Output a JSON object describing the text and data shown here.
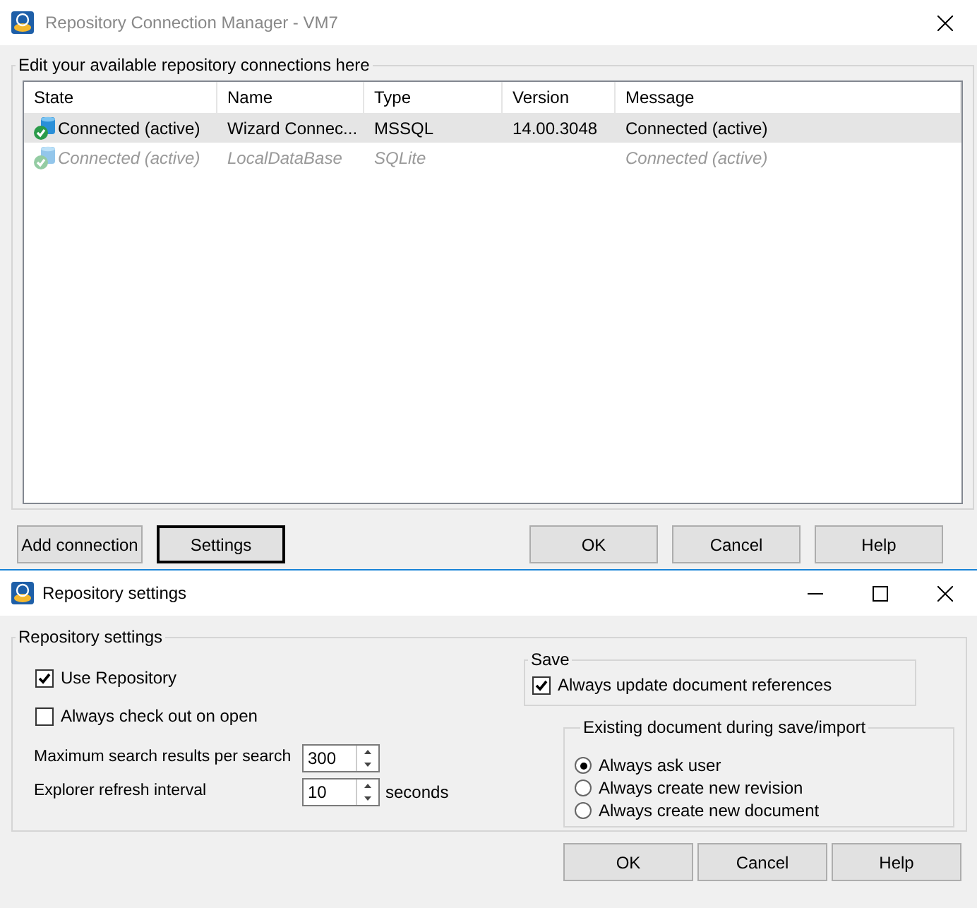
{
  "main_window": {
    "title": "Repository Connection Manager - VM7",
    "active": false,
    "group_label": "Edit your available repository connections here",
    "columns": [
      "State",
      "Name",
      "Type",
      "Version",
      "Message"
    ],
    "rows": [
      {
        "state": "Connected (active)",
        "name": "Wizard Connec...",
        "type": "MSSQL",
        "version": "14.00.3048",
        "message": "Connected (active)",
        "selected": true,
        "disabled": false
      },
      {
        "state": "Connected (active)",
        "name": "LocalDataBase",
        "type": "SQLite",
        "message": "Connected (active)",
        "selected": false,
        "disabled": true
      }
    ],
    "left_buttons": [
      {
        "label": "Add connection",
        "default": false
      },
      {
        "label": "Settings",
        "default": true
      }
    ],
    "buttons": [
      "OK",
      "Cancel",
      "Help"
    ]
  },
  "settings_window": {
    "title": "Repository settings",
    "active": true,
    "group_label": "Repository settings",
    "checks": [
      {
        "label": "Use Repository",
        "checked": true
      },
      {
        "label": "Always check out on open",
        "checked": false
      }
    ],
    "fields": [
      {
        "label": "Maximum search results per search",
        "value": "300"
      },
      {
        "label": "Explorer refresh interval",
        "value": "10",
        "unit": "seconds"
      }
    ],
    "save": {
      "title": "Save",
      "checks": [
        {
          "label": "Always update document references",
          "checked": true
        }
      ]
    },
    "existing": {
      "title": "Existing document during save/import",
      "options": [
        {
          "label": "Always ask user",
          "selected": true
        },
        {
          "label": "Always create new revision",
          "selected": false
        },
        {
          "label": "Always create new document",
          "selected": false
        }
      ]
    },
    "buttons": [
      "OK",
      "Cancel",
      "Help"
    ]
  }
}
